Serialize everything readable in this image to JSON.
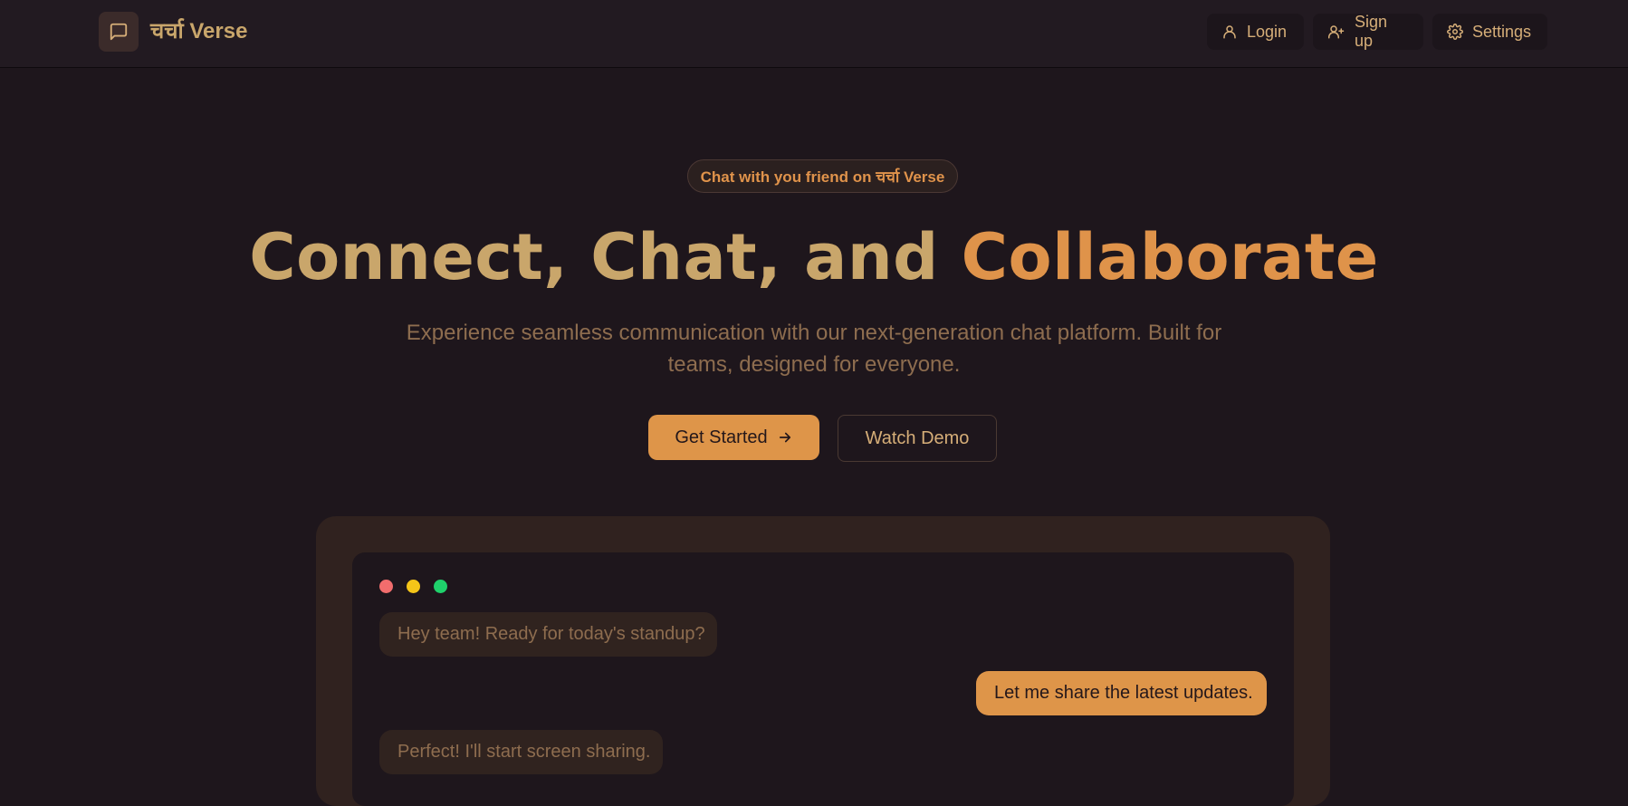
{
  "header": {
    "logo_icon": "message-square-icon",
    "brand": "चर्चा Verse",
    "nav": [
      {
        "label": "Login",
        "icon": "user-icon"
      },
      {
        "label": "Sign up",
        "icon": "user-plus-icon"
      },
      {
        "label": "Settings",
        "icon": "gear-icon"
      }
    ]
  },
  "hero": {
    "pill": "Chat with you friend on चर्चा Verse",
    "title_part1": "Connect, Chat, and ",
    "title_part2": "Collaborate",
    "subtitle": "Experience seamless communication with our next-generation chat platform. Built for teams, designed for everyone.",
    "primary_button": "Get Started",
    "primary_button_icon": "arrow-right-icon",
    "secondary_button": "Watch Demo"
  },
  "preview": {
    "window_dots": [
      "#f26d6d",
      "#f5c518",
      "#1fd16b"
    ],
    "messages": [
      {
        "text": "Hey team! Ready for today's standup?",
        "side": "left"
      },
      {
        "text": "Let me share the latest updates.",
        "side": "right"
      },
      {
        "text": "Perfect! I'll start screen sharing.",
        "side": "left"
      }
    ]
  },
  "colors": {
    "background": "#1e161c",
    "accent": "#de9549",
    "gold": "#c9a66b"
  }
}
